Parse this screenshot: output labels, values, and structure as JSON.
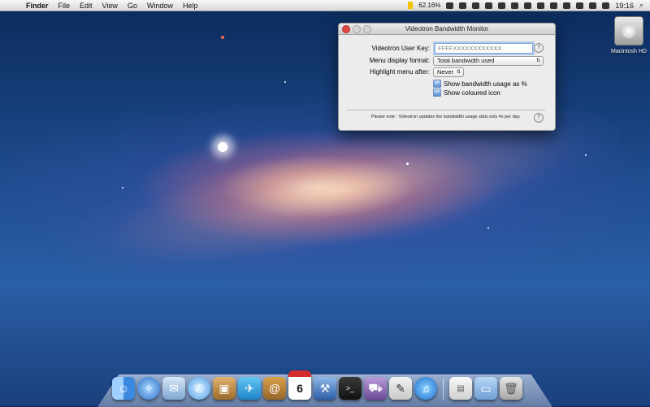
{
  "menubar": {
    "app_name": "Finder",
    "menus": [
      "File",
      "Edit",
      "View",
      "Go",
      "Window",
      "Help"
    ],
    "status": {
      "bandwidth_percent": "62.16%",
      "clock": "19:16"
    }
  },
  "window": {
    "title": "Videotron Bandwidth Monitor",
    "user_key_label": "Videotron User Key:",
    "user_key_value": "FFFFXXXXXXXXXXXX",
    "menu_display_label": "Menu display format:",
    "menu_display_value": "Total bandwidth used",
    "highlight_label": "Highlight menu after:",
    "highlight_value": "Never",
    "checkbox_show_percent": "Show bandwidth usage as %",
    "checkbox_show_colored": "Show coloured icon",
    "note": "Please note : Videotron updates the bandwidth usage stats only 4x per day.",
    "help_glyph": "?"
  },
  "desktop": {
    "drive_label": "Macintosh HD"
  },
  "dock": {
    "apps": [
      "finder",
      "safari",
      "mail-stamp",
      "ichat",
      "box",
      "twitter",
      "address-book",
      "calendar",
      "xcode",
      "terminal",
      "truck",
      "preview",
      "itunes"
    ],
    "calendar_day": "6",
    "stacks": [
      "document",
      "folder",
      "trash"
    ]
  }
}
